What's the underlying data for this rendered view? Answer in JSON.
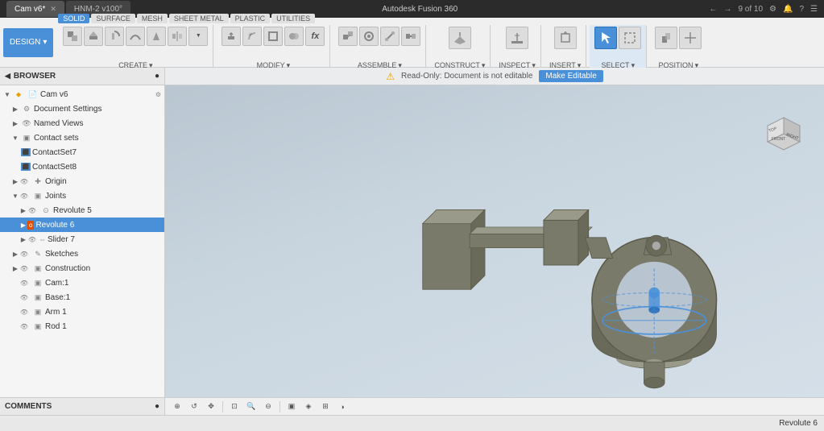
{
  "titlebar": {
    "tabs": [
      {
        "label": "Cam v6*",
        "active": true
      },
      {
        "label": "HNM-2 v100°",
        "active": false
      }
    ],
    "window_controls": [
      "←",
      "→",
      "9 of 10",
      "⚙",
      "🔔",
      "?",
      "☰"
    ]
  },
  "toolbar": {
    "design_label": "DESIGN",
    "sections": [
      {
        "name": "SOLID",
        "active": true,
        "subsections": [
          "SURFACE",
          "MESH",
          "SHEET METAL",
          "PLASTIC",
          "UTILITIES"
        ]
      }
    ],
    "groups": [
      {
        "label": "CREATE ▾",
        "icons": [
          "box",
          "extrude",
          "revolve",
          "sweep",
          "loft",
          "mirror",
          "more"
        ]
      },
      {
        "label": "MODIFY ▾",
        "icons": [
          "push",
          "shell",
          "fillet",
          "chamfer",
          "combine",
          "fx"
        ]
      },
      {
        "label": "ASSEMBLE ▾",
        "icons": [
          "joint",
          "asbuilt",
          "motion",
          "contact"
        ]
      },
      {
        "label": "CONSTRUCT ▾",
        "icons": [
          "plane",
          "axis",
          "point"
        ]
      },
      {
        "label": "INSPECT ▾",
        "icons": [
          "measure",
          "section",
          "interference"
        ]
      },
      {
        "label": "INSERT ▾",
        "icons": [
          "insert",
          "decal",
          "canvas"
        ]
      },
      {
        "label": "SELECT ▾",
        "icons": [
          "select",
          "window",
          "freeform"
        ],
        "active_icon": 0
      },
      {
        "label": "POSITION ▾",
        "icons": [
          "align",
          "joint"
        ]
      }
    ]
  },
  "browser": {
    "title": "BROWSER",
    "items": [
      {
        "id": "cam-v6",
        "label": "Cam v6",
        "level": 0,
        "has_arrow": true,
        "expanded": true,
        "icon": "doc"
      },
      {
        "id": "doc-settings",
        "label": "Document Settings",
        "level": 1,
        "has_arrow": true,
        "expanded": false,
        "icon": "gear"
      },
      {
        "id": "named-views",
        "label": "Named Views",
        "level": 1,
        "has_arrow": true,
        "expanded": false,
        "icon": "eye"
      },
      {
        "id": "contact-sets",
        "label": "Contact sets",
        "level": 1,
        "has_arrow": true,
        "expanded": true,
        "icon": "folder"
      },
      {
        "id": "contact-set7",
        "label": "ContactSet7",
        "level": 2,
        "has_arrow": false,
        "icon": "contact"
      },
      {
        "id": "contact-set8",
        "label": "ContactSet8",
        "level": 2,
        "has_arrow": false,
        "icon": "contact"
      },
      {
        "id": "origin",
        "label": "Origin",
        "level": 1,
        "has_arrow": true,
        "expanded": false,
        "icon": "origin"
      },
      {
        "id": "joints",
        "label": "Joints",
        "level": 1,
        "has_arrow": true,
        "expanded": true,
        "icon": "folder"
      },
      {
        "id": "revolute5",
        "label": "Revolute 5",
        "level": 2,
        "has_arrow": true,
        "icon": "revolute"
      },
      {
        "id": "revolute6",
        "label": "Revolute 6",
        "level": 2,
        "has_arrow": true,
        "icon": "revolute",
        "selected": true
      },
      {
        "id": "slider7",
        "label": "Slider 7",
        "level": 2,
        "has_arrow": true,
        "icon": "slider"
      },
      {
        "id": "sketches",
        "label": "Sketches",
        "level": 1,
        "has_arrow": true,
        "expanded": false,
        "icon": "sketch"
      },
      {
        "id": "construction",
        "label": "Construction",
        "level": 1,
        "has_arrow": true,
        "expanded": false,
        "icon": "construction"
      },
      {
        "id": "cam1",
        "label": "Cam:1",
        "level": 1,
        "has_arrow": false,
        "icon": "body"
      },
      {
        "id": "base1",
        "label": "Base:1",
        "level": 1,
        "has_arrow": false,
        "icon": "body"
      },
      {
        "id": "arm1",
        "label": "Arm 1",
        "level": 1,
        "has_arrow": false,
        "icon": "body"
      },
      {
        "id": "rod1",
        "label": "Rod 1",
        "level": 1,
        "has_arrow": false,
        "icon": "body"
      }
    ]
  },
  "viewport": {
    "readonly_text": "Read-Only:  Document is not editable",
    "make_editable_label": "Make Editable"
  },
  "status_bar": {
    "active_joint": "Revolute 6"
  },
  "comments": {
    "label": "COMMENTS"
  }
}
